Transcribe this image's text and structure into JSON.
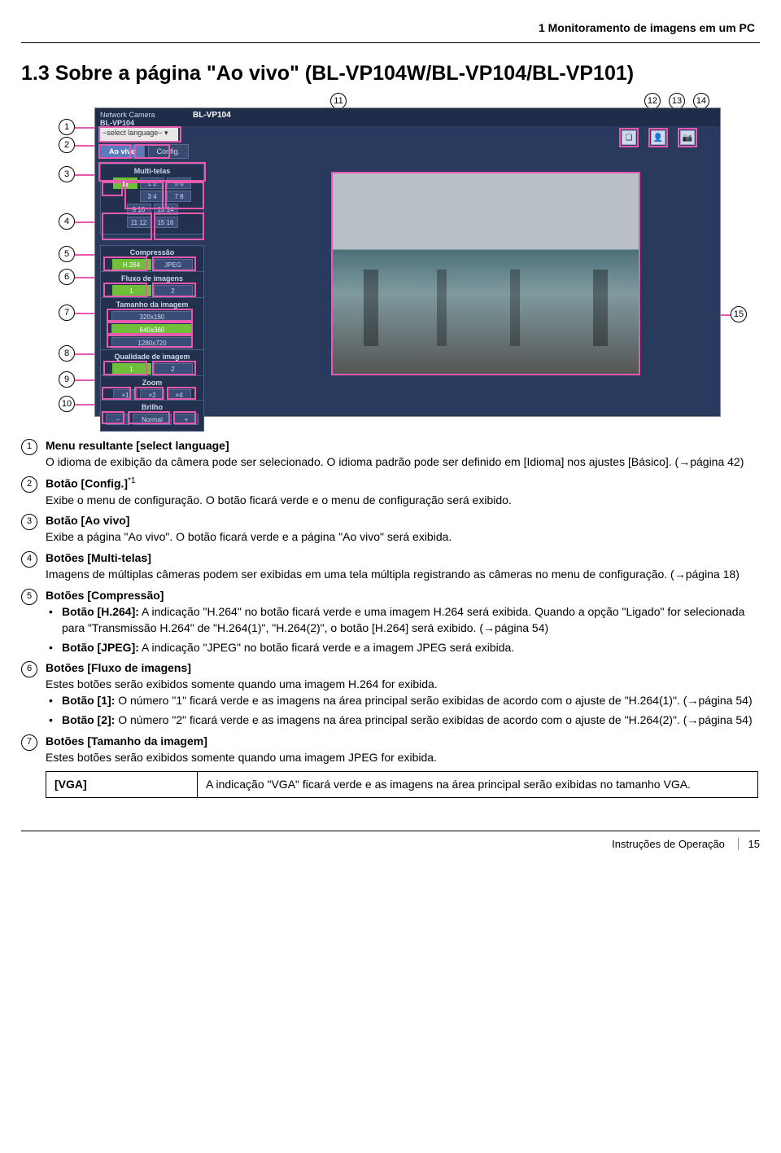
{
  "header": {
    "chapter": "1 Monitoramento de imagens em um PC"
  },
  "title": "1.3  Sobre a página \"Ao vivo\" (BL-VP104W/BL-VP104/BL-VP101)",
  "callouts": [
    "1",
    "2",
    "3",
    "4",
    "5",
    "6",
    "7",
    "8",
    "9",
    "10",
    "11",
    "12",
    "13",
    "14",
    "15"
  ],
  "shot": {
    "brand": "Network Camera",
    "brand2": "BL-VP104",
    "model": "BL-VP104",
    "lang_placeholder": "−select language− ▾",
    "tabs": {
      "live": "Ao vivo",
      "config": "Config."
    },
    "panels": {
      "multi": {
        "title": "Multi-telas",
        "r1": [
          "1 2",
          "5 6"
        ],
        "r2": [
          "3 4",
          "7 8"
        ],
        "r3": [
          "9 10",
          "13 14"
        ],
        "r4": [
          "11 12",
          "15 16"
        ]
      },
      "comp": {
        "title": "Compressão",
        "btns": [
          "H.264",
          "JPEG"
        ]
      },
      "flux": {
        "title": "Fluxo de imagens",
        "btns": [
          "1",
          "2"
        ]
      },
      "size": {
        "title": "Tamanho da imagem",
        "btns": [
          "320x180",
          "640x360",
          "1280x720"
        ]
      },
      "qual": {
        "title": "Qualidade de imagem",
        "btns": [
          "1",
          "2"
        ]
      },
      "zoom": {
        "title": "Zoom",
        "btns": [
          "×1",
          "×2",
          "×4"
        ]
      },
      "bri": {
        "title": "Brilho",
        "btns": [
          "−",
          "Normal",
          "+"
        ]
      }
    },
    "icons": [
      "❏",
      "👤",
      "📷"
    ]
  },
  "items": {
    "i1": {
      "head": "Menu resultante [select language]",
      "p1": "O idioma de exibição da câmera pode ser selecionado. O idioma padrão pode ser definido em [Idioma] nos ajustes [Básico]. (→página 42)"
    },
    "i2": {
      "head_pre": "Botão [Config.]",
      "sup": "*1",
      "p1": "Exibe o menu de configuração. O botão ficará verde e o menu de configuração será exibido."
    },
    "i3": {
      "head": "Botão [Ao vivo]",
      "p1": "Exibe a página \"Ao vivo\". O botão ficará verde e a página \"Ao vivo\" será exibida."
    },
    "i4": {
      "head": "Botões [Multi-telas]",
      "p1": "Imagens de múltiplas câmeras podem ser exibidas em uma tela múltipla registrando as câmeras no menu de configuração. (→página 18)"
    },
    "i5": {
      "head": "Botões [Compressão]",
      "b1_pre": "Botão [H.264]:",
      "b1_txt": " A indicação \"H.264\" no botão ficará verde e uma imagem H.264 será exibida. Quando a opção \"Ligado\" for selecionada para \"Transmissão H.264\" de \"H.264(1)\", \"H.264(2)\", o botão [H.264] será exibido. (→página 54)",
      "b2_pre": "Botão [JPEG]:",
      "b2_txt": " A indicação \"JPEG\" no botão ficará verde e a imagem JPEG será exibida."
    },
    "i6": {
      "head": "Botões [Fluxo de imagens]",
      "p1": "Estes botões serão exibidos somente quando uma imagem H.264 for exibida.",
      "b1_pre": "Botão [1]:",
      "b1_txt": " O número \"1\" ficará verde e as imagens na área principal serão exibidas de acordo com o ajuste de \"H.264(1)\". (→página 54)",
      "b2_pre": "Botão [2]:",
      "b2_txt": " O número \"2\" ficará verde e as imagens na área principal serão exibidas de acordo com o ajuste de \"H.264(2)\". (→página 54)"
    },
    "i7": {
      "head": "Botões [Tamanho da imagem]",
      "p1": "Estes botões serão exibidos somente quando uma imagem JPEG for exibida.",
      "tbl_k": "[VGA]",
      "tbl_v": "A indicação \"VGA\" ficará verde e as imagens na área principal serão exibidas no tamanho VGA."
    }
  },
  "footer": {
    "label": "Instruções de Operação",
    "page": "15"
  }
}
